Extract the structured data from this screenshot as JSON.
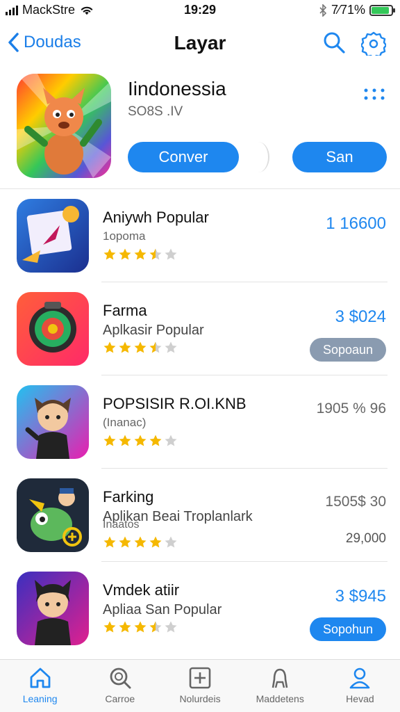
{
  "status_bar": {
    "carrier": "MackStre",
    "time": "19:29",
    "battery_text": "7⁄71%",
    "battery_level": 0.9,
    "battery_color": "#34c759"
  },
  "nav": {
    "back_label": "Doudas",
    "title": "Layar",
    "search_icon": "search-icon",
    "settings_icon": "settings-icon"
  },
  "featured": {
    "title": "Iindonessia",
    "subtitle": "SO8S .IV",
    "button_primary": "Conver",
    "button_secondary": "San",
    "menu_icon": "more-dots-icon"
  },
  "list": [
    {
      "title": "Aniywh Popular",
      "subtitle": "1opoma",
      "rating": 3.5,
      "price": "1  16600",
      "price_style": "blue",
      "icon_theme": "paper-plane"
    },
    {
      "title": "Farma",
      "subtitle": "Aplkasir Popular",
      "rating": 3.5,
      "price": "3 $024",
      "price_style": "blue",
      "button": "Sopoaun",
      "button_style": "gray",
      "icon_theme": "ring"
    },
    {
      "title": "POPSISIR R.OI.KNB",
      "subtitle": "(Inanac)",
      "rating": 4,
      "price": "1905 % 96",
      "price_style": "gray",
      "icon_theme": "cat-suit"
    },
    {
      "title": "Farking",
      "subtitle": "Aplikan Beai Troplanlark",
      "note": "Inaatos",
      "rating": 4,
      "price": "1505$ 30",
      "price_style": "gray",
      "extra": "29,000",
      "icon_theme": "creature"
    },
    {
      "title": "Vmdek atiir",
      "subtitle": "Apliaa San Popular",
      "rating": 3.5,
      "price": "3 $945",
      "price_style": "blue",
      "button": "Sopohun",
      "button_style": "blue",
      "icon_theme": "cat-girl"
    }
  ],
  "tabs": [
    {
      "label": "Leaning",
      "icon": "home-icon",
      "active": true
    },
    {
      "label": "Carroe",
      "icon": "search-icon",
      "active": false
    },
    {
      "label": "Nolurdeis",
      "icon": "plus-box-icon",
      "active": false
    },
    {
      "label": "Maddetens",
      "icon": "person-outline-icon",
      "active": false
    },
    {
      "label": "Hevad",
      "icon": "profile-icon",
      "active": false
    }
  ],
  "colors": {
    "accent": "#1e87ef",
    "star": "#f5b800",
    "star_empty": "#cfcfcf"
  }
}
